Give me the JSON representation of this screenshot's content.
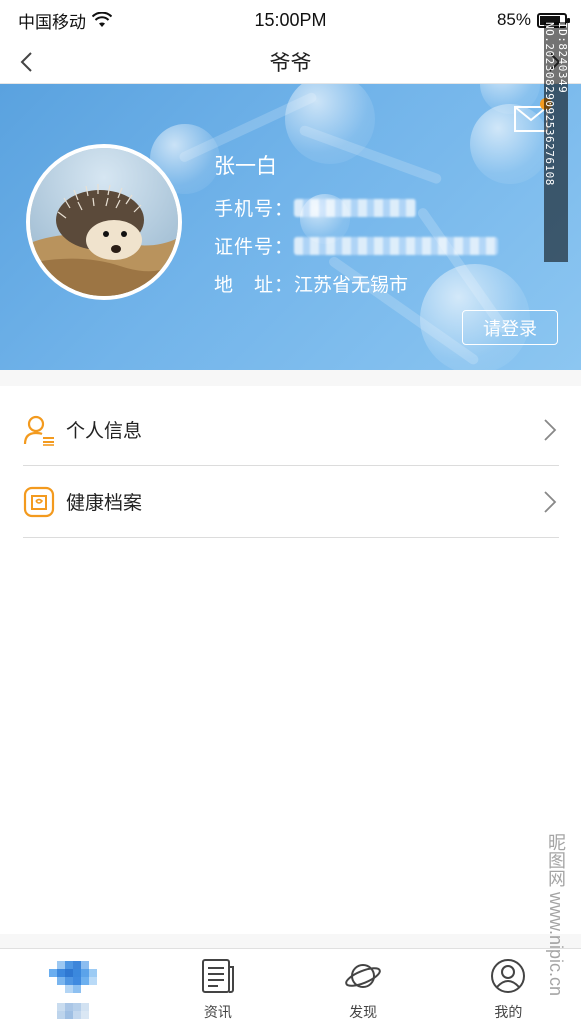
{
  "status_bar": {
    "carrier": "中国移动",
    "time": "15:00PM",
    "battery": "85%",
    "battery_level": 0.85
  },
  "nav": {
    "title": "爷爷"
  },
  "profile": {
    "name": "张一白",
    "phone_label": "手机号：",
    "id_label": "证件号：",
    "address_label": "地　址：",
    "address_value": "江苏省无锡市",
    "login_button": "请登录"
  },
  "menu": [
    {
      "label": "个人信息",
      "icon": "person-info-icon"
    },
    {
      "label": "健康档案",
      "icon": "health-record-icon"
    }
  ],
  "tabs": [
    {
      "label": "",
      "icon": "home-icon"
    },
    {
      "label": "资讯",
      "icon": "news-icon"
    },
    {
      "label": "发现",
      "icon": "planet-icon"
    },
    {
      "label": "我的",
      "icon": "user-icon"
    }
  ],
  "watermark": {
    "id": "ID:8240349 NO.20230829092536276108",
    "brand": "昵图网 www.nipic.cn"
  },
  "colors": {
    "accent": "#f39a1e",
    "banner": "#6aaee6"
  }
}
